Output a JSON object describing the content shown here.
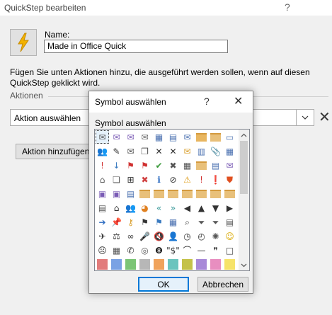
{
  "quickstep": {
    "title": "QuickStep bearbeiten",
    "help_glyph": "?",
    "name_label": "Name:",
    "name_value": "Made in Office Quick",
    "description": "Fügen Sie unten Aktionen hinzu, die ausgeführt werden sollen, wenn auf diesen QuickStep geklickt wird.",
    "actions_label": "Aktionen",
    "action_select_value": "Aktion auswählen",
    "add_action_label": "Aktion hinzufügen"
  },
  "icon_dialog": {
    "title": "Symbol auswählen",
    "help_glyph": "?",
    "close_glyph": "✕",
    "grid_label": "Symbol auswählen",
    "ok_label": "OK",
    "cancel_label": "Abbrechen",
    "selected_icon_index": 0,
    "icons": [
      {
        "name": "envelope-icon",
        "kind": "g",
        "g": "✉",
        "c": "#555555"
      },
      {
        "name": "reply-icon",
        "kind": "g",
        "g": "✉",
        "c": "#7a5bb5"
      },
      {
        "name": "reply-all-icon",
        "kind": "g",
        "g": "✉",
        "c": "#7a5bb5"
      },
      {
        "name": "open-envelope-icon",
        "kind": "g",
        "g": "✉",
        "c": "#666666"
      },
      {
        "name": "calendar-icon",
        "kind": "g",
        "g": "▦",
        "c": "#4a70b0"
      },
      {
        "name": "contact-card-icon",
        "kind": "g",
        "g": "▤",
        "c": "#4a70b0"
      },
      {
        "name": "send-icon",
        "kind": "g",
        "g": "✉",
        "c": "#4a70b0"
      },
      {
        "name": "folder-move-icon",
        "kind": "s",
        "c": "#e8b660"
      },
      {
        "name": "folder-icon",
        "kind": "s",
        "c": "#e8c07a"
      },
      {
        "name": "document-icon",
        "kind": "g",
        "g": "▭",
        "c": "#4a70b0"
      },
      {
        "name": "group-icon",
        "kind": "g",
        "g": "👥",
        "c": "#3a7ac0"
      },
      {
        "name": "edit-icon",
        "kind": "g",
        "g": "✎",
        "c": "#333333"
      },
      {
        "name": "mail-search-icon",
        "kind": "g",
        "g": "✉",
        "c": "#555555"
      },
      {
        "name": "copy-icon",
        "kind": "g",
        "g": "❐",
        "c": "#555555"
      },
      {
        "name": "delete-icon",
        "kind": "g",
        "g": "✕",
        "c": "#333333"
      },
      {
        "name": "delete-all-icon",
        "kind": "g",
        "g": "✕",
        "c": "#333333"
      },
      {
        "name": "mail-icon",
        "kind": "g",
        "g": "✉",
        "c": "#d9a030"
      },
      {
        "name": "notes-icon",
        "kind": "g",
        "g": "▥",
        "c": "#4a70b0"
      },
      {
        "name": "attach-icon",
        "kind": "g",
        "g": "📎",
        "c": "#555555"
      },
      {
        "name": "meeting-icon",
        "kind": "g",
        "g": "▦",
        "c": "#4a70b0"
      },
      {
        "name": "important-icon",
        "kind": "g",
        "g": "!",
        "c": "#d03030"
      },
      {
        "name": "low-importance-icon",
        "kind": "g",
        "g": "↓",
        "c": "#3a7ac0"
      },
      {
        "name": "flag-delete-icon",
        "kind": "g",
        "g": "⚑",
        "c": "#d03030"
      },
      {
        "name": "flag-icon",
        "kind": "g",
        "g": "⚑",
        "c": "#d03030"
      },
      {
        "name": "check-icon",
        "kind": "g",
        "g": "✔",
        "c": "#3a9a3a"
      },
      {
        "name": "cancel-icon",
        "kind": "g",
        "g": "✖",
        "c": "#555555"
      },
      {
        "name": "calendar-delete-icon",
        "kind": "g",
        "g": "▦",
        "c": "#555555"
      },
      {
        "name": "folder-delete-icon",
        "kind": "s",
        "c": "#e8c07a"
      },
      {
        "name": "document-x-icon",
        "kind": "g",
        "g": "▤",
        "c": "#4a70b0"
      },
      {
        "name": "forward-icon",
        "kind": "g",
        "g": "✉",
        "c": "#7a5bb5"
      },
      {
        "name": "rules-icon",
        "kind": "g",
        "g": "⌂",
        "c": "#555555"
      },
      {
        "name": "attachment-doc-icon",
        "kind": "g",
        "g": "❏",
        "c": "#555555"
      },
      {
        "name": "org-chart-icon",
        "kind": "g",
        "g": "⊞",
        "c": "#333333"
      },
      {
        "name": "red-x-icon",
        "kind": "g",
        "g": "✖",
        "c": "#d04040"
      },
      {
        "name": "info-icon",
        "kind": "g",
        "g": "ℹ",
        "c": "#2a6ac0"
      },
      {
        "name": "block-icon",
        "kind": "g",
        "g": "⊘",
        "c": "#333333"
      },
      {
        "name": "warning-icon",
        "kind": "g",
        "g": "⚠",
        "c": "#e0a020"
      },
      {
        "name": "alert-icon",
        "kind": "g",
        "g": "!",
        "c": "#d03030"
      },
      {
        "name": "exclamation-icon",
        "kind": "g",
        "g": "❗",
        "c": "#d03030"
      },
      {
        "name": "shield-icon",
        "kind": "g",
        "g": "⛊",
        "c": "#e05020"
      },
      {
        "name": "save-icon",
        "kind": "g",
        "g": "▣",
        "c": "#7a5bb5"
      },
      {
        "name": "save-as-icon",
        "kind": "g",
        "g": "▣",
        "c": "#7a5bb5"
      },
      {
        "name": "folder-list-icon",
        "kind": "g",
        "g": "▤",
        "c": "#4a70b0"
      },
      {
        "name": "folder-open-icon",
        "kind": "s",
        "c": "#e8c07a"
      },
      {
        "name": "folder-up-icon",
        "kind": "s",
        "c": "#e8c07a"
      },
      {
        "name": "folder-plus-icon",
        "kind": "s",
        "c": "#e8c07a"
      },
      {
        "name": "folder-arrow-icon",
        "kind": "s",
        "c": "#e8c07a"
      },
      {
        "name": "folder-back-icon",
        "kind": "s",
        "c": "#e8c07a"
      },
      {
        "name": "folder-forward-icon",
        "kind": "s",
        "c": "#e8c07a"
      },
      {
        "name": "folder-new-icon",
        "kind": "s",
        "c": "#e8c07a"
      },
      {
        "name": "document-tag-icon",
        "kind": "g",
        "g": "▤",
        "c": "#555555"
      },
      {
        "name": "home-icon",
        "kind": "g",
        "g": "⌂",
        "c": "#333333"
      },
      {
        "name": "people-icon",
        "kind": "g",
        "g": "👥",
        "c": "#3a7ac0"
      },
      {
        "name": "pie-chart-icon",
        "kind": "g",
        "g": "◕",
        "c": "#e08020"
      },
      {
        "name": "back-double-icon",
        "kind": "g",
        "g": "«",
        "c": "#3a9a9a"
      },
      {
        "name": "forward-double-icon",
        "kind": "g",
        "g": "»",
        "c": "#3a9a9a"
      },
      {
        "name": "arrow-left-icon",
        "kind": "g",
        "g": "◀",
        "c": "#333333"
      },
      {
        "name": "arrow-up-icon",
        "kind": "g",
        "g": "▲",
        "c": "#333333"
      },
      {
        "name": "arrow-down-icon",
        "kind": "g",
        "g": "▼",
        "c": "#333333"
      },
      {
        "name": "arrow-right-icon",
        "kind": "g",
        "g": "▶",
        "c": "#333333"
      },
      {
        "name": "circle-right-icon",
        "kind": "g",
        "g": "➔",
        "c": "#2a6ac0"
      },
      {
        "name": "pin-icon",
        "kind": "g",
        "g": "📌",
        "c": "#333333"
      },
      {
        "name": "key-icon",
        "kind": "g",
        "g": "⚷",
        "c": "#d9a030"
      },
      {
        "name": "bookmark-icon",
        "kind": "g",
        "g": "⚑",
        "c": "#333333"
      },
      {
        "name": "flag-blue-icon",
        "kind": "g",
        "g": "⚑",
        "c": "#3a7ac0"
      },
      {
        "name": "table-icon",
        "kind": "g",
        "g": "▦",
        "c": "#4a70b0"
      },
      {
        "name": "search-icon",
        "kind": "g",
        "g": "⌕",
        "c": "#333333"
      },
      {
        "name": "funnel-icon",
        "kind": "g",
        "g": "⏷",
        "c": "#555555"
      },
      {
        "name": "filter-icon",
        "kind": "g",
        "g": "⏷",
        "c": "#555555"
      },
      {
        "name": "notepad-icon",
        "kind": "g",
        "g": "▤",
        "c": "#555555"
      },
      {
        "name": "pushpin-icon",
        "kind": "g",
        "g": "✈",
        "c": "#333333"
      },
      {
        "name": "scale-icon",
        "kind": "g",
        "g": "⚖",
        "c": "#333333"
      },
      {
        "name": "glasses-icon",
        "kind": "g",
        "g": "∞",
        "c": "#333333"
      },
      {
        "name": "microphone-icon",
        "kind": "g",
        "g": "🎤",
        "c": "#333333"
      },
      {
        "name": "mute-icon",
        "kind": "g",
        "g": "🔇",
        "c": "#333333"
      },
      {
        "name": "person-icon",
        "kind": "g",
        "g": "👤",
        "c": "#333333"
      },
      {
        "name": "clock-icon",
        "kind": "g",
        "g": "◷",
        "c": "#333333"
      },
      {
        "name": "clock-alarm-icon",
        "kind": "g",
        "g": "◴",
        "c": "#333333"
      },
      {
        "name": "sparkle-icon",
        "kind": "g",
        "g": "✺",
        "c": "#555555"
      },
      {
        "name": "smiley-icon",
        "kind": "g",
        "g": "☺",
        "c": "#d9a800"
      },
      {
        "name": "sad-face-icon",
        "kind": "g",
        "g": "☹",
        "c": "#333333"
      },
      {
        "name": "calculator-icon",
        "kind": "g",
        "g": "▦",
        "c": "#555555"
      },
      {
        "name": "phone-icon",
        "kind": "g",
        "g": "✆",
        "c": "#333333"
      },
      {
        "name": "piggy-bank-icon",
        "kind": "g",
        "g": "◎",
        "c": "#555555"
      },
      {
        "name": "eight-ball-icon",
        "kind": "g",
        "g": "❽",
        "c": "#111111"
      },
      {
        "name": "currency-icon",
        "kind": "g",
        "g": "\"$\"",
        "c": "#333333"
      },
      {
        "name": "eye-icon",
        "kind": "g",
        "g": "⌒",
        "c": "#333333"
      },
      {
        "name": "line-icon",
        "kind": "g",
        "g": "—",
        "c": "#333333"
      },
      {
        "name": "quote-icon",
        "kind": "g",
        "g": "❞",
        "c": "#333333"
      },
      {
        "name": "square-outline-icon",
        "kind": "g",
        "g": "□",
        "c": "#333333"
      },
      {
        "name": "color-red-icon",
        "kind": "c",
        "c": "#e27c7c"
      },
      {
        "name": "color-blue-icon",
        "kind": "c",
        "c": "#7aa2e4"
      },
      {
        "name": "color-green-icon",
        "kind": "c",
        "c": "#7cc576"
      },
      {
        "name": "color-gray-icon",
        "kind": "c",
        "c": "#b7b7b7"
      },
      {
        "name": "color-orange-icon",
        "kind": "c",
        "c": "#f0a35c"
      },
      {
        "name": "color-teal-icon",
        "kind": "c",
        "c": "#6bc4be"
      },
      {
        "name": "color-olive-icon",
        "kind": "c",
        "c": "#c4c24a"
      },
      {
        "name": "color-purple-icon",
        "kind": "c",
        "c": "#a889d8"
      },
      {
        "name": "color-pink-icon",
        "kind": "c",
        "c": "#e88ec0"
      },
      {
        "name": "color-yellow-icon",
        "kind": "c",
        "c": "#f6e36a"
      }
    ]
  }
}
